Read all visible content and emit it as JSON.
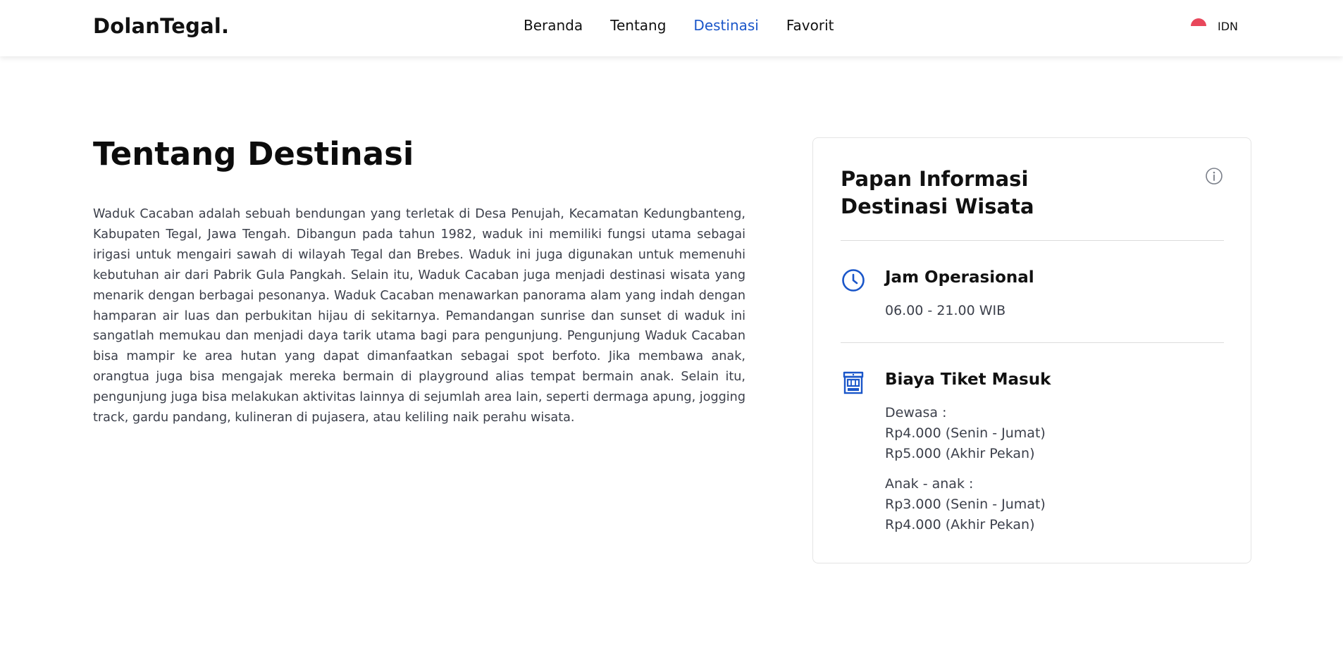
{
  "brand": "DolanTegal.",
  "nav": {
    "items": [
      {
        "label": "Beranda",
        "active": false
      },
      {
        "label": "Tentang",
        "active": false
      },
      {
        "label": "Destinasi",
        "active": true
      },
      {
        "label": "Favorit",
        "active": false
      }
    ],
    "language": "IDN"
  },
  "colors": {
    "accent": "#1a56c9",
    "flag_red": "#e8475b",
    "text": "#111111",
    "muted_text": "#3b3f4a"
  },
  "main": {
    "title": "Tentang Destinasi",
    "description": "Waduk Cacaban adalah sebuah bendungan yang terletak di Desa Penujah, Kecamatan Kedungbanteng, Kabupaten Tegal, Jawa Tengah. Dibangun pada tahun 1982, waduk ini memiliki fungsi utama sebagai irigasi untuk mengairi sawah di wilayah Tegal dan Brebes. Waduk ini juga digunakan untuk memenuhi kebutuhan air dari Pabrik Gula Pangkah. Selain itu, Waduk Cacaban juga menjadi destinasi wisata yang menarik dengan berbagai pesonanya. Waduk Cacaban menawarkan panorama alam yang indah dengan hamparan air luas dan perbukitan hijau di sekitarnya. Pemandangan sunrise dan sunset di waduk ini sangatlah memukau dan menjadi daya tarik utama bagi para pengunjung. Pengunjung Waduk Cacaban bisa mampir ke area hutan yang dapat dimanfaatkan sebagai spot berfoto. Jika membawa anak, orangtua juga bisa mengajak mereka bermain di playground alias tempat bermain anak. Selain itu, pengunjung juga bisa melakukan aktivitas lainnya di sejumlah area lain, seperti dermaga apung, jogging track, gardu pandang, kulineran di pujasera, atau keliling naik perahu wisata."
  },
  "info_card": {
    "title_line1": "Papan Informasi",
    "title_line2": "Destinasi Wisata",
    "info_icon": "info-circle-icon",
    "hours": {
      "icon": "clock-icon",
      "title": "Jam Operasional",
      "value": "06.00 - 21.00 WIB"
    },
    "tickets": {
      "icon": "ticket-booth-icon",
      "title": "Biaya Tiket Masuk",
      "adult": {
        "label": "Dewasa :",
        "weekday": "Rp4.000 (Senin - Jumat)",
        "weekend": "Rp5.000 (Akhir Pekan)"
      },
      "child": {
        "label": "Anak - anak :",
        "weekday": "Rp3.000 (Senin - Jumat)",
        "weekend": "Rp4.000 (Akhir Pekan)"
      }
    }
  }
}
